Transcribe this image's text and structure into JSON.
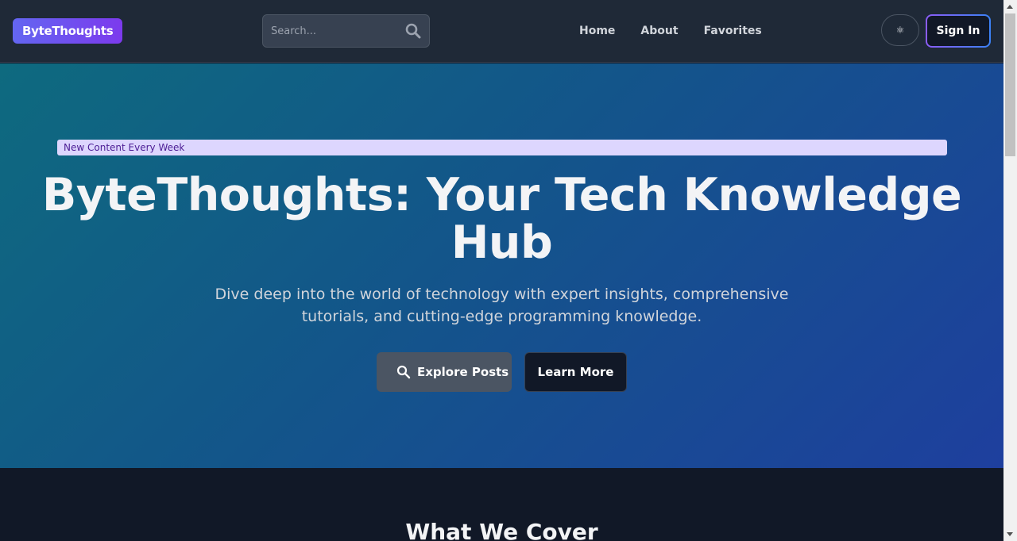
{
  "navbar": {
    "logo": "ByteThoughts",
    "search_placeholder": "Search...",
    "search_icon": "search-icon",
    "links": [
      "Home",
      "About",
      "Favorites"
    ],
    "theme_toggle": "⚛",
    "signin": "Sign In"
  },
  "hero": {
    "badge": "New Content Every Week",
    "title": "ByteThoughts: Your Tech Knowledge Hub",
    "subtitle": "Dive deep into the world of technology with expert insights, comprehensive tutorials, and cutting-edge programming knowledge.",
    "explore_btn": "Explore Posts",
    "explore_icon": "search-icon",
    "learn_btn": "Learn More"
  },
  "section": {
    "title": "What We Cover"
  },
  "colors": {
    "navbar_bg": "#1f2937",
    "page_bg": "#111827",
    "logo_gradient_start": "#6366f1",
    "logo_gradient_end": "#7c3aed",
    "badge_bg": "#ddd6fe",
    "hero_gradient_start": "#0e6a7f",
    "hero_gradient_end": "#1e3f9e"
  }
}
